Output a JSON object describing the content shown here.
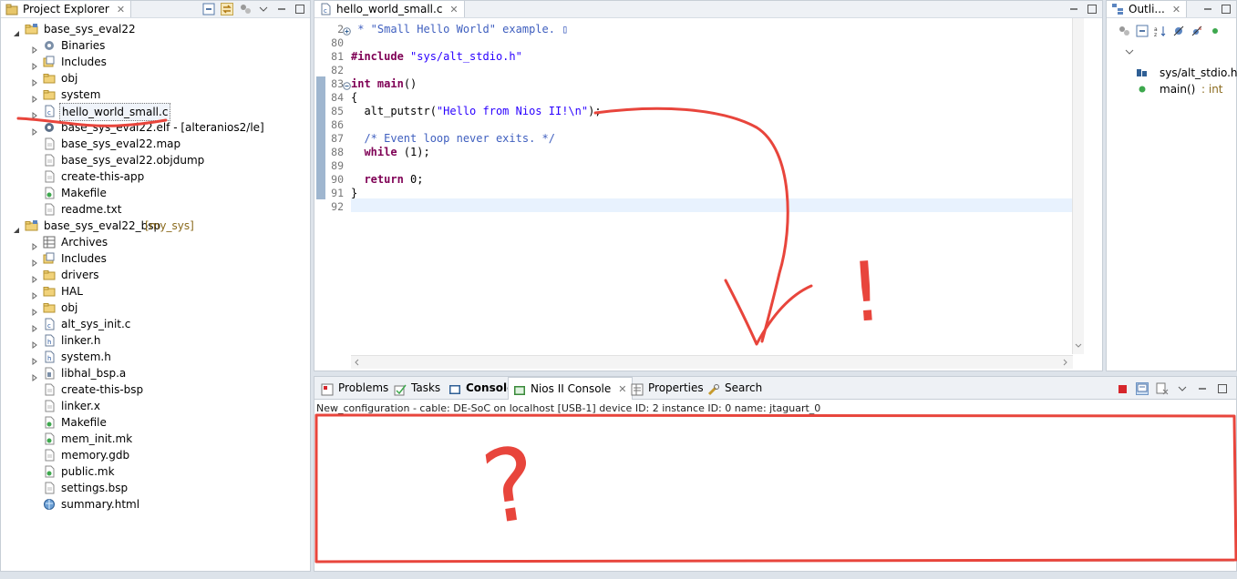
{
  "explorer": {
    "tab_label": "Project Explorer",
    "projects": [
      {
        "label": "base_sys_eval22",
        "decoration": "",
        "children": [
          {
            "label": "Binaries",
            "icon": "binaries-icon",
            "expandable": true
          },
          {
            "label": "Includes",
            "icon": "includes-icon",
            "expandable": true
          },
          {
            "label": "obj",
            "icon": "folder-icon",
            "expandable": true
          },
          {
            "label": "system",
            "icon": "folder-icon",
            "expandable": true
          },
          {
            "label": "hello_world_small.c",
            "icon": "c-file-icon",
            "expandable": true,
            "selected": true
          },
          {
            "label": "base_sys_eval22.elf - [alteranios2/le]",
            "icon": "elf-icon",
            "expandable": true
          },
          {
            "label": "base_sys_eval22.map",
            "icon": "file-icon",
            "expandable": false
          },
          {
            "label": "base_sys_eval22.objdump",
            "icon": "file-icon",
            "expandable": false
          },
          {
            "label": "create-this-app",
            "icon": "file-icon",
            "expandable": false
          },
          {
            "label": "Makefile",
            "icon": "makefile-icon",
            "expandable": false
          },
          {
            "label": "readme.txt",
            "icon": "file-icon",
            "expandable": false
          }
        ]
      },
      {
        "label": "base_sys_eval22_bsp",
        "decoration": "[my_sys]",
        "children": [
          {
            "label": "Archives",
            "icon": "archives-icon",
            "expandable": true
          },
          {
            "label": "Includes",
            "icon": "includes-icon",
            "expandable": true
          },
          {
            "label": "drivers",
            "icon": "folder-icon",
            "expandable": true
          },
          {
            "label": "HAL",
            "icon": "folder-icon",
            "expandable": true
          },
          {
            "label": "obj",
            "icon": "folder-icon",
            "expandable": true
          },
          {
            "label": "alt_sys_init.c",
            "icon": "c-file-icon",
            "expandable": true
          },
          {
            "label": "linker.h",
            "icon": "h-file-icon",
            "expandable": true
          },
          {
            "label": "system.h",
            "icon": "h-file-icon",
            "expandable": true
          },
          {
            "label": "libhal_bsp.a",
            "icon": "lib-icon",
            "expandable": true
          },
          {
            "label": "create-this-bsp",
            "icon": "file-icon",
            "expandable": false
          },
          {
            "label": "linker.x",
            "icon": "file-icon",
            "expandable": false
          },
          {
            "label": "Makefile",
            "icon": "makefile-icon",
            "expandable": false
          },
          {
            "label": "mem_init.mk",
            "icon": "makefile-icon",
            "expandable": false
          },
          {
            "label": "memory.gdb",
            "icon": "file-icon",
            "expandable": false
          },
          {
            "label": "public.mk",
            "icon": "makefile-icon",
            "expandable": false
          },
          {
            "label": "settings.bsp",
            "icon": "file-icon",
            "expandable": false
          },
          {
            "label": "summary.html",
            "icon": "html-icon",
            "expandable": false
          }
        ]
      }
    ]
  },
  "editor": {
    "tab_label": "hello_world_small.c",
    "lines": [
      {
        "num": "2",
        "fold": "plus",
        "parts": [
          {
            "t": " * \"Small Hello World\" example. ",
            "c": "cmt"
          },
          {
            "t": "▯",
            "c": "cmt"
          }
        ]
      },
      {
        "num": "80",
        "parts": []
      },
      {
        "num": "81",
        "parts": [
          {
            "t": "#include ",
            "c": "kw"
          },
          {
            "t": "\"sys/alt_stdio.h\"",
            "c": "str"
          }
        ]
      },
      {
        "num": "82",
        "parts": []
      },
      {
        "num": "83",
        "fold": "minus",
        "parts": [
          {
            "t": "int",
            "c": "kw"
          },
          {
            "t": " "
          },
          {
            "t": "main",
            "c": "kw"
          },
          {
            "t": "()"
          }
        ]
      },
      {
        "num": "84",
        "parts": [
          {
            "t": "{"
          }
        ]
      },
      {
        "num": "85",
        "parts": [
          {
            "t": "  alt_putstr("
          },
          {
            "t": "\"Hello from Nios II!\\n\"",
            "c": "str"
          },
          {
            "t": ");"
          }
        ]
      },
      {
        "num": "86",
        "parts": []
      },
      {
        "num": "87",
        "parts": [
          {
            "t": "  /* Event loop never exits. */",
            "c": "cmt"
          }
        ]
      },
      {
        "num": "88",
        "parts": [
          {
            "t": "  "
          },
          {
            "t": "while",
            "c": "kw"
          },
          {
            "t": " (1);"
          }
        ]
      },
      {
        "num": "89",
        "parts": []
      },
      {
        "num": "90",
        "parts": [
          {
            "t": "  "
          },
          {
            "t": "return",
            "c": "kw"
          },
          {
            "t": " 0;"
          }
        ]
      },
      {
        "num": "91",
        "parts": [
          {
            "t": "}"
          }
        ]
      },
      {
        "num": "92",
        "parts": []
      }
    ]
  },
  "outline": {
    "tab_label": "Outli...",
    "items": [
      {
        "label": "sys/alt_stdio.h",
        "suffix": "",
        "icon": "include-icon"
      },
      {
        "label": "main()",
        "suffix": " : int",
        "icon": "function-icon"
      }
    ]
  },
  "console": {
    "tabs": [
      {
        "label": "Problems",
        "icon": "problems-icon"
      },
      {
        "label": "Tasks",
        "icon": "tasks-icon"
      },
      {
        "label": "Console",
        "icon": "console-icon",
        "bold": true
      },
      {
        "label": "Nios II Console",
        "icon": "nios-console-icon",
        "active": true
      },
      {
        "label": "Properties",
        "icon": "properties-icon"
      },
      {
        "label": "Search",
        "icon": "search-icon"
      }
    ],
    "info": "New_configuration - cable: DE-SoC on localhost [USB-1] device ID: 2 instance ID: 0 name: jtaguart_0",
    "output": ""
  },
  "annotations": {
    "color": "#e8453c",
    "marks": [
      "!",
      "?"
    ]
  }
}
